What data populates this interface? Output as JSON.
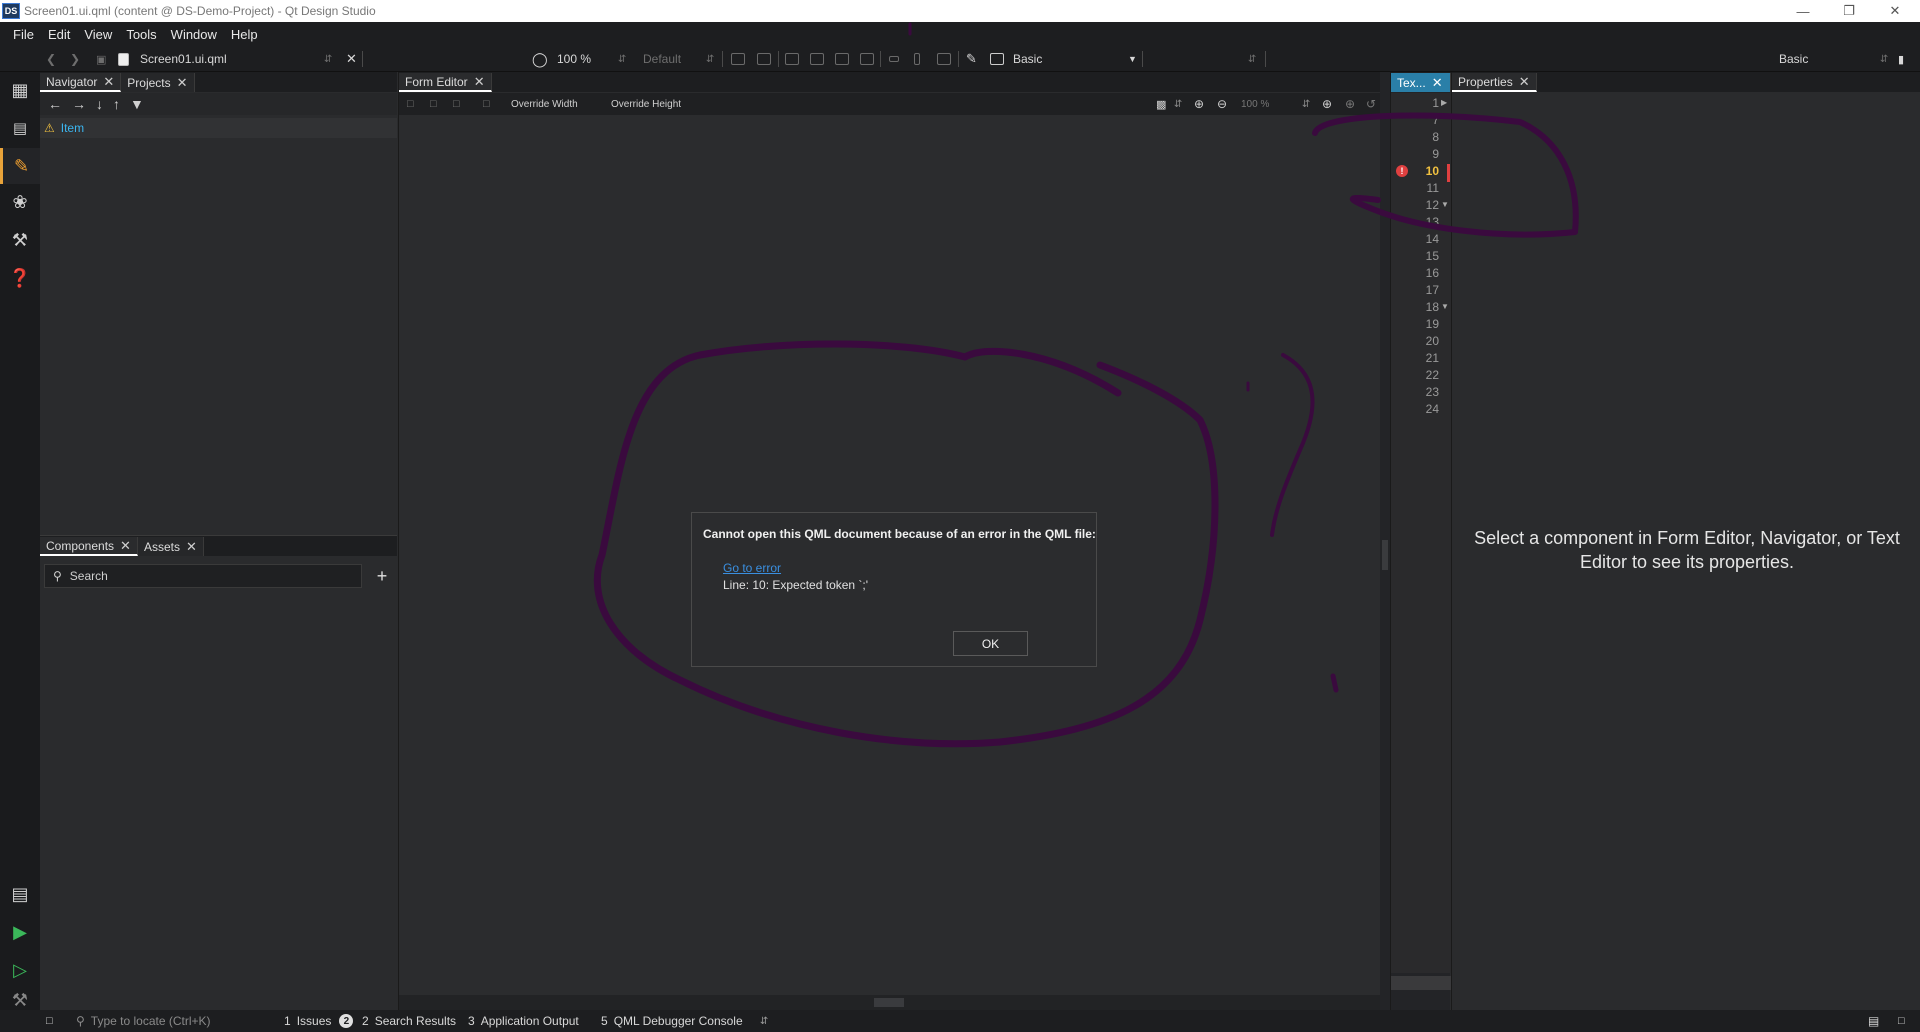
{
  "window": {
    "logo_text": "DS",
    "title": "Screen01.ui.qml (content @ DS-Demo-Project) - Qt Design Studio"
  },
  "menu": [
    "File",
    "Edit",
    "View",
    "Tools",
    "Window",
    "Help"
  ],
  "toolbar": {
    "file_name": "Screen01.ui.qml",
    "zoom": "100 %",
    "state": "Default",
    "style": "Basic",
    "workspace": "Basic"
  },
  "navigator": {
    "tabs": [
      "Navigator",
      "Projects"
    ],
    "tree_item": "Item"
  },
  "components": {
    "tabs": [
      "Components",
      "Assets"
    ],
    "search_placeholder": "Search",
    "add_label": "+"
  },
  "form_editor": {
    "tab": "Form Editor",
    "override_width": "Override Width",
    "override_height": "Override Height",
    "zoom": "100 %"
  },
  "dialog": {
    "message": "Cannot open this QML document because of an error in the QML file:",
    "link": "Go to error",
    "detail": "Line: 10: Expected token `;'",
    "ok": "OK"
  },
  "text_editor": {
    "tab": "Tex...",
    "line_numbers": [
      "1",
      "7",
      "8",
      "9",
      "10",
      "11",
      "12",
      "13",
      "14",
      "15",
      "16",
      "17",
      "18",
      "19",
      "20",
      "21",
      "22",
      "23",
      "24"
    ],
    "error_line": "10"
  },
  "properties": {
    "tab": "Properties",
    "message": "Select a component in Form Editor, Navigator, or Text Editor to see its properties."
  },
  "statusbar": {
    "locate_placeholder": "Type to locate (Ctrl+K)",
    "issues_num": "1",
    "issues": "Issues",
    "issues_count": "2",
    "search_num": "2",
    "search": "Search Results",
    "output_num": "3",
    "output": "Application Output",
    "debug_num": "5",
    "debug": "QML Debugger Console"
  },
  "colors": {
    "annotation": "#3a0a3e",
    "accent": "#e8a33a",
    "link": "#3a8fe0",
    "error": "#e04040"
  }
}
